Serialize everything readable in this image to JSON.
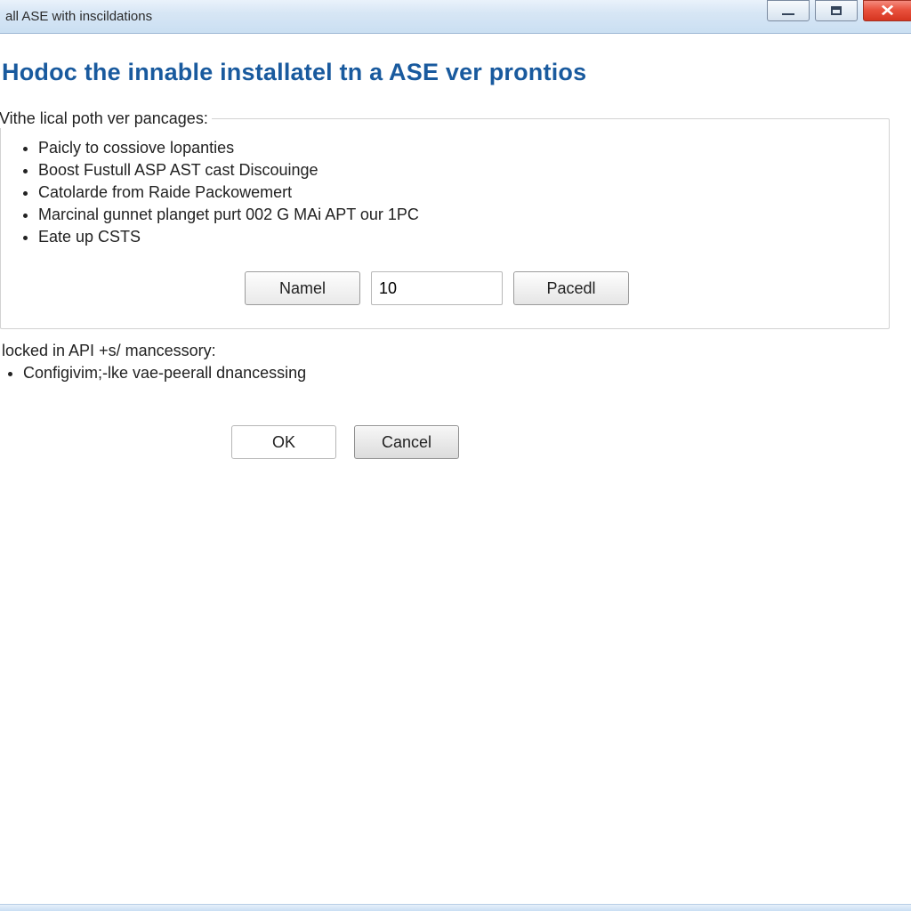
{
  "window": {
    "title": "all ASE with inscildations"
  },
  "heading": "Hodoc the innable installatel tn a ASE ver prontios",
  "group1": {
    "legend": "Vithe lical poth ver pancages:",
    "items": [
      "Paicly to cossiove lopanties",
      "Boost Fustull ASP AST cast Discouinge",
      "Catolarde from Raide Packowemert",
      "Marcinal gunnet planget purt 002 G MAi APT our 1PC",
      "Eate up CSTS"
    ],
    "controls": {
      "name_button": "Namel",
      "value_input": "10",
      "paced_button": "Pacedl"
    }
  },
  "group2": {
    "legend": "locked in API +s/ mancessory:",
    "items": [
      "Configivim;-lke vae-peerall dnancessing"
    ]
  },
  "dialog": {
    "ok": "OK",
    "cancel": "Cancel"
  }
}
